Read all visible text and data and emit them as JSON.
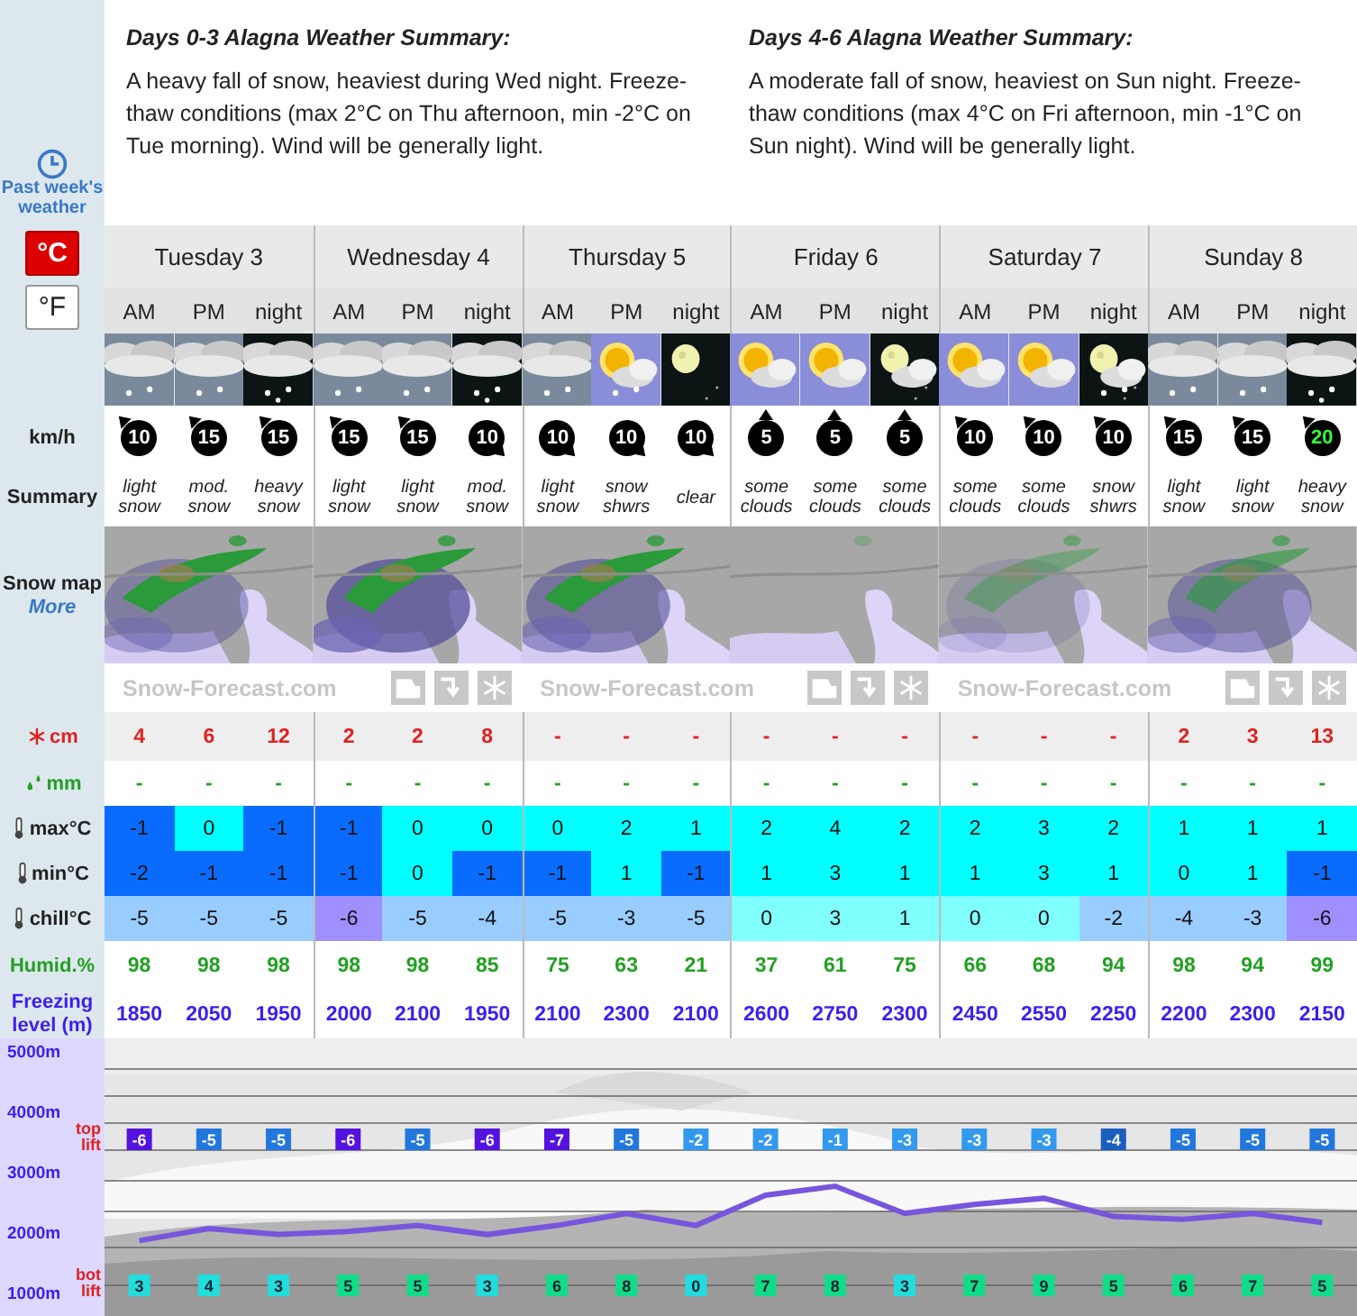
{
  "sidebar": {
    "past_weather_link": "Past week's weather",
    "units": [
      {
        "label": "°C",
        "selected": true
      },
      {
        "label": "°F",
        "selected": false
      }
    ],
    "wind_label": "km/h",
    "summary_label": "Summary",
    "snow_map_label": "Snow map",
    "more_link": "More",
    "snow_label": "cm",
    "rain_label": "mm",
    "max_label": "max°C",
    "min_label": "min°C",
    "chill_label": "chill°C",
    "humidity_label": "Humid.%",
    "freezing_label": "Freezing level (m)"
  },
  "summaries": [
    {
      "title": "Days 0-3 Alagna Weather Summary:",
      "text": "A heavy fall of snow, heaviest during Wed night. Freeze-thaw conditions (max 2°C on Thu afternoon, min -2°C on Tue morning). Wind will be generally light."
    },
    {
      "title": "Days 4-6 Alagna Weather Summary:",
      "text": "A moderate fall of snow, heaviest on Sun night. Freeze-thaw conditions (max 4°C on Fri afternoon, min -1°C on Sun night). Wind will be generally light."
    }
  ],
  "days": [
    {
      "name": "Tuesday 3",
      "periods": [
        {
          "label": "AM",
          "kind": "cloud-snow",
          "wind": {
            "speed": "10",
            "kind": "nw",
            "color": "#ffffff"
          },
          "summary": "light snow",
          "snow_cm": "4",
          "rain_mm": "-",
          "max": {
            "value": "-1",
            "color": "#0a6cff"
          },
          "min": {
            "value": "-2",
            "color": "#0a6cff"
          },
          "chill": {
            "value": "-5",
            "color": "#99ccff"
          },
          "humidity": "98",
          "freezing": "1850",
          "top_lift": {
            "value": "-6",
            "color": "#5511dd"
          },
          "bot_lift": {
            "value": "3",
            "color": "#22dddd"
          }
        },
        {
          "label": "PM",
          "kind": "cloud-snow",
          "wind": {
            "speed": "15",
            "kind": "nw",
            "color": "#ffffff"
          },
          "summary": "mod. snow",
          "snow_cm": "6",
          "rain_mm": "-",
          "max": {
            "value": "0",
            "color": "#00ffff"
          },
          "min": {
            "value": "-1",
            "color": "#0a6cff"
          },
          "chill": {
            "value": "-5",
            "color": "#99ccff"
          },
          "humidity": "98",
          "freezing": "2050",
          "top_lift": {
            "value": "-5",
            "color": "#2277dd"
          },
          "bot_lift": {
            "value": "4",
            "color": "#22dddd"
          }
        },
        {
          "label": "night",
          "kind": "cloud-snow-night",
          "wind": {
            "speed": "15",
            "kind": "nw",
            "color": "#ffffff"
          },
          "summary": "heavy snow",
          "snow_cm": "12",
          "rain_mm": "-",
          "max": {
            "value": "-1",
            "color": "#0a6cff"
          },
          "min": {
            "value": "-1",
            "color": "#0a6cff"
          },
          "chill": {
            "value": "-5",
            "color": "#99ccff"
          },
          "humidity": "98",
          "freezing": "1950",
          "top_lift": {
            "value": "-5",
            "color": "#2277dd"
          },
          "bot_lift": {
            "value": "3",
            "color": "#22dddd"
          }
        }
      ]
    },
    {
      "name": "Wednesday 4",
      "periods": [
        {
          "label": "AM",
          "kind": "cloud-snow",
          "wind": {
            "speed": "15",
            "kind": "nw",
            "color": "#ffffff"
          },
          "summary": "light snow",
          "snow_cm": "2",
          "rain_mm": "-",
          "max": {
            "value": "-1",
            "color": "#0a6cff"
          },
          "min": {
            "value": "-1",
            "color": "#0a6cff"
          },
          "chill": {
            "value": "-6",
            "color": "#9f8fff"
          },
          "humidity": "98",
          "freezing": "2000",
          "top_lift": {
            "value": "-6",
            "color": "#5511dd"
          },
          "bot_lift": {
            "value": "5",
            "color": "#11dd88"
          }
        },
        {
          "label": "PM",
          "kind": "cloud-snow",
          "wind": {
            "speed": "15",
            "kind": "nw",
            "color": "#ffffff"
          },
          "summary": "light snow",
          "snow_cm": "2",
          "rain_mm": "-",
          "max": {
            "value": "0",
            "color": "#00ffff"
          },
          "min": {
            "value": "0",
            "color": "#00ffff"
          },
          "chill": {
            "value": "-5",
            "color": "#99ccff"
          },
          "humidity": "98",
          "freezing": "2100",
          "top_lift": {
            "value": "-5",
            "color": "#2277dd"
          },
          "bot_lift": {
            "value": "5",
            "color": "#11dd88"
          }
        },
        {
          "label": "night",
          "kind": "cloud-snow-night",
          "wind": {
            "speed": "10",
            "kind": "se",
            "color": "#ffffff"
          },
          "summary": "mod. snow",
          "snow_cm": "8",
          "rain_mm": "-",
          "max": {
            "value": "0",
            "color": "#00ffff"
          },
          "min": {
            "value": "-1",
            "color": "#0a6cff"
          },
          "chill": {
            "value": "-4",
            "color": "#99ccff"
          },
          "humidity": "85",
          "freezing": "1950",
          "top_lift": {
            "value": "-6",
            "color": "#5511dd"
          },
          "bot_lift": {
            "value": "3",
            "color": "#22dddd"
          }
        }
      ]
    },
    {
      "name": "Thursday 5",
      "periods": [
        {
          "label": "AM",
          "kind": "cloud-snow",
          "wind": {
            "speed": "10",
            "kind": "se",
            "color": "#ffffff"
          },
          "summary": "light snow",
          "snow_cm": "-",
          "rain_mm": "-",
          "max": {
            "value": "0",
            "color": "#00ffff"
          },
          "min": {
            "value": "-1",
            "color": "#0a6cff"
          },
          "chill": {
            "value": "-5",
            "color": "#99ccff"
          },
          "humidity": "75",
          "freezing": "2100",
          "top_lift": {
            "value": "-7",
            "color": "#5511dd"
          },
          "bot_lift": {
            "value": "6",
            "color": "#11dd88"
          }
        },
        {
          "label": "PM",
          "kind": "sun-cloud-snow",
          "wind": {
            "speed": "10",
            "kind": "se",
            "color": "#ffffff"
          },
          "summary": "snow shwrs",
          "snow_cm": "-",
          "rain_mm": "-",
          "max": {
            "value": "2",
            "color": "#00ffff"
          },
          "min": {
            "value": "1",
            "color": "#00ffff"
          },
          "chill": {
            "value": "-3",
            "color": "#99ccff"
          },
          "humidity": "63",
          "freezing": "2300",
          "top_lift": {
            "value": "-5",
            "color": "#2277dd"
          },
          "bot_lift": {
            "value": "8",
            "color": "#11dd88"
          }
        },
        {
          "label": "night",
          "kind": "moon",
          "wind": {
            "speed": "10",
            "kind": "se",
            "color": "#ffffff"
          },
          "summary": "clear",
          "snow_cm": "-",
          "rain_mm": "-",
          "max": {
            "value": "1",
            "color": "#00ffff"
          },
          "min": {
            "value": "-1",
            "color": "#0a6cff"
          },
          "chill": {
            "value": "-5",
            "color": "#99ccff"
          },
          "humidity": "21",
          "freezing": "2100",
          "top_lift": {
            "value": "-2",
            "color": "#3399ee"
          },
          "bot_lift": {
            "value": "0",
            "color": "#22dddd"
          }
        }
      ]
    },
    {
      "name": "Friday 6",
      "periods": [
        {
          "label": "AM",
          "kind": "sun-cloud",
          "wind": {
            "speed": "5",
            "kind": "n",
            "color": "#ffffff"
          },
          "summary": "some clouds",
          "snow_cm": "-",
          "rain_mm": "-",
          "max": {
            "value": "2",
            "color": "#00ffff"
          },
          "min": {
            "value": "1",
            "color": "#00ffff"
          },
          "chill": {
            "value": "0",
            "color": "#80ffff"
          },
          "humidity": "37",
          "freezing": "2600",
          "top_lift": {
            "value": "-2",
            "color": "#3399ee"
          },
          "bot_lift": {
            "value": "7",
            "color": "#11dd88"
          }
        },
        {
          "label": "PM",
          "kind": "sun-cloud",
          "wind": {
            "speed": "5",
            "kind": "n",
            "color": "#ffffff"
          },
          "summary": "some clouds",
          "snow_cm": "-",
          "rain_mm": "-",
          "max": {
            "value": "4",
            "color": "#00ffff"
          },
          "min": {
            "value": "3",
            "color": "#00ffff"
          },
          "chill": {
            "value": "3",
            "color": "#80ffff"
          },
          "humidity": "61",
          "freezing": "2750",
          "top_lift": {
            "value": "-1",
            "color": "#3399ee"
          },
          "bot_lift": {
            "value": "8",
            "color": "#11dd88"
          }
        },
        {
          "label": "night",
          "kind": "moon-cloud",
          "wind": {
            "speed": "5",
            "kind": "n",
            "color": "#ffffff"
          },
          "summary": "some clouds",
          "snow_cm": "-",
          "rain_mm": "-",
          "max": {
            "value": "2",
            "color": "#00ffff"
          },
          "min": {
            "value": "1",
            "color": "#00ffff"
          },
          "chill": {
            "value": "1",
            "color": "#80ffff"
          },
          "humidity": "75",
          "freezing": "2300",
          "top_lift": {
            "value": "-3",
            "color": "#3399ee"
          },
          "bot_lift": {
            "value": "3",
            "color": "#22dddd"
          }
        }
      ]
    },
    {
      "name": "Saturday 7",
      "periods": [
        {
          "label": "AM",
          "kind": "sun-cloud",
          "wind": {
            "speed": "10",
            "kind": "nw",
            "color": "#ffffff"
          },
          "summary": "some clouds",
          "snow_cm": "-",
          "rain_mm": "-",
          "max": {
            "value": "2",
            "color": "#00ffff"
          },
          "min": {
            "value": "1",
            "color": "#00ffff"
          },
          "chill": {
            "value": "0",
            "color": "#80ffff"
          },
          "humidity": "66",
          "freezing": "2450",
          "top_lift": {
            "value": "-3",
            "color": "#3399ee"
          },
          "bot_lift": {
            "value": "7",
            "color": "#11dd88"
          }
        },
        {
          "label": "PM",
          "kind": "sun-cloud",
          "wind": {
            "speed": "10",
            "kind": "nw",
            "color": "#ffffff"
          },
          "summary": "some clouds",
          "snow_cm": "-",
          "rain_mm": "-",
          "max": {
            "value": "3",
            "color": "#00ffff"
          },
          "min": {
            "value": "3",
            "color": "#00ffff"
          },
          "chill": {
            "value": "0",
            "color": "#80ffff"
          },
          "humidity": "68",
          "freezing": "2550",
          "top_lift": {
            "value": "-3",
            "color": "#3399ee"
          },
          "bot_lift": {
            "value": "9",
            "color": "#11dd88"
          }
        },
        {
          "label": "night",
          "kind": "moon-cloud-snow",
          "wind": {
            "speed": "10",
            "kind": "nw",
            "color": "#ffffff"
          },
          "summary": "snow shwrs",
          "snow_cm": "-",
          "rain_mm": "-",
          "max": {
            "value": "2",
            "color": "#00ffff"
          },
          "min": {
            "value": "1",
            "color": "#00ffff"
          },
          "chill": {
            "value": "-2",
            "color": "#99ccff"
          },
          "humidity": "94",
          "freezing": "2250",
          "top_lift": {
            "value": "-4",
            "color": "#1a5fbf"
          },
          "bot_lift": {
            "value": "5",
            "color": "#11dd88"
          }
        }
      ]
    },
    {
      "name": "Sunday 8",
      "periods": [
        {
          "label": "AM",
          "kind": "cloud-snow",
          "wind": {
            "speed": "15",
            "kind": "nw",
            "color": "#ffffff"
          },
          "summary": "light snow",
          "snow_cm": "2",
          "rain_mm": "-",
          "max": {
            "value": "1",
            "color": "#00ffff"
          },
          "min": {
            "value": "0",
            "color": "#00ffff"
          },
          "chill": {
            "value": "-4",
            "color": "#99ccff"
          },
          "humidity": "98",
          "freezing": "2200",
          "top_lift": {
            "value": "-5",
            "color": "#2277dd"
          },
          "bot_lift": {
            "value": "6",
            "color": "#11dd88"
          }
        },
        {
          "label": "PM",
          "kind": "cloud-snow",
          "wind": {
            "speed": "15",
            "kind": "nw",
            "color": "#ffffff"
          },
          "summary": "light snow",
          "snow_cm": "3",
          "rain_mm": "-",
          "max": {
            "value": "1",
            "color": "#00ffff"
          },
          "min": {
            "value": "1",
            "color": "#00ffff"
          },
          "chill": {
            "value": "-3",
            "color": "#99ccff"
          },
          "humidity": "94",
          "freezing": "2300",
          "top_lift": {
            "value": "-5",
            "color": "#2277dd"
          },
          "bot_lift": {
            "value": "7",
            "color": "#11dd88"
          }
        },
        {
          "label": "night",
          "kind": "cloud-snow-night",
          "wind": {
            "speed": "20",
            "kind": "nw",
            "color": "#33ff33"
          },
          "summary": "heavy snow",
          "snow_cm": "13",
          "rain_mm": "-",
          "max": {
            "value": "1",
            "color": "#00ffff"
          },
          "min": {
            "value": "-1",
            "color": "#0a6cff"
          },
          "chill": {
            "value": "-6",
            "color": "#9f8fff"
          },
          "humidity": "99",
          "freezing": "2150",
          "top_lift": {
            "value": "-5",
            "color": "#2277dd"
          },
          "bot_lift": {
            "value": "5",
            "color": "#11dd88"
          }
        }
      ]
    }
  ],
  "map_credits": [
    "Snow-Forecast.com",
    "Snow-Forecast.com",
    "Snow-Forecast.com"
  ],
  "lift_chart": {
    "top_lift_label": "top lift",
    "bot_lift_label": "bot lift",
    "chart_data": {
      "type": "line",
      "ylim": [
        600,
        5200
      ],
      "yticks": [
        {
          "value": 5000,
          "label": "5000m"
        },
        {
          "value": 4000,
          "label": "4000m"
        },
        {
          "value": 3000,
          "label": "3000m"
        },
        {
          "value": 2000,
          "label": "2000m"
        },
        {
          "value": 1000,
          "label": "1000m"
        }
      ],
      "series": [
        {
          "color": "#7755dd",
          "values": [
            1850,
            2050,
            1950,
            2000,
            2100,
            1950,
            2100,
            2300,
            2100,
            2600,
            2750,
            2300,
            2450,
            2550,
            2250,
            2200,
            2300,
            2150
          ]
        }
      ]
    }
  }
}
